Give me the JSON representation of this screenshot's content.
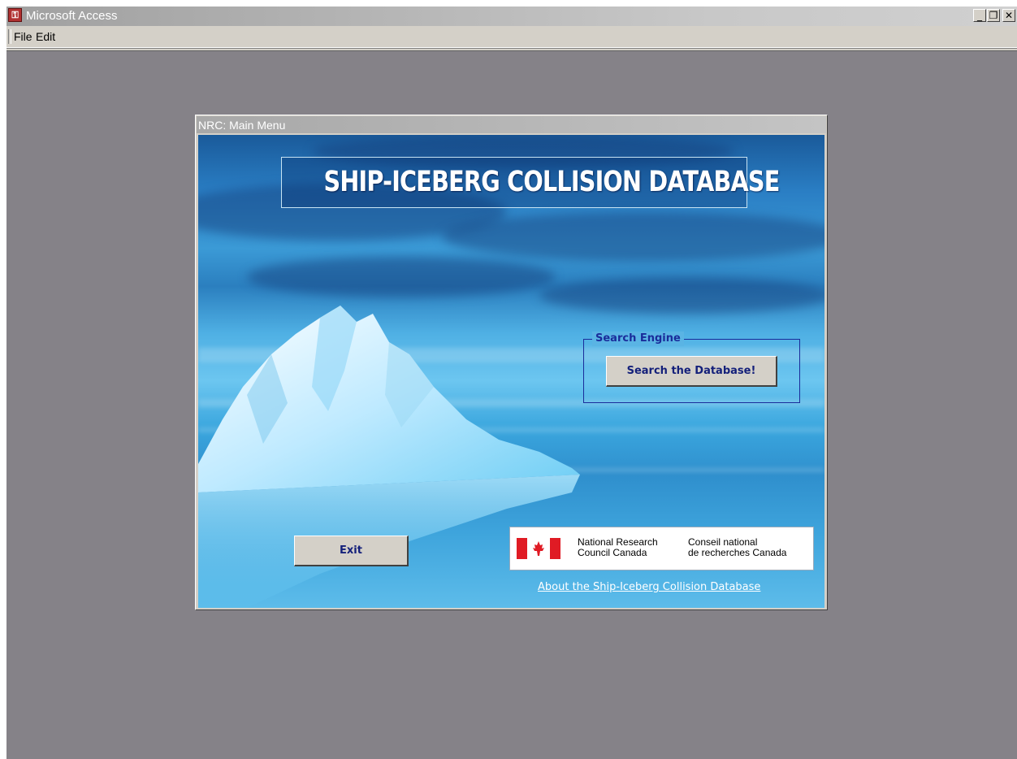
{
  "app": {
    "title": "Microsoft Access",
    "icon": "access-key-icon",
    "window_controls": [
      "minimize",
      "restore",
      "close"
    ]
  },
  "menu": {
    "items": [
      "File",
      "Edit"
    ]
  },
  "form": {
    "title": "NRC: Main Menu",
    "banner_title": "SHIP-ICEBERG COLLISION DATABASE",
    "search_engine": {
      "label": "Search Engine",
      "button_label": "Search the Database!"
    },
    "exit_button_label": "Exit",
    "nrc_logo": {
      "english_line1": "National Research",
      "english_line2": "Council Canada",
      "french_line1": "Conseil national",
      "french_line2": "de recherches Canada"
    },
    "about_link": "About the Ship-Iceberg Collision  Database"
  },
  "colors": {
    "mdi_background": "#858288",
    "button_text": "#14207a",
    "frame_border": "#1a2c9a",
    "flag_red": "#e01b24"
  }
}
